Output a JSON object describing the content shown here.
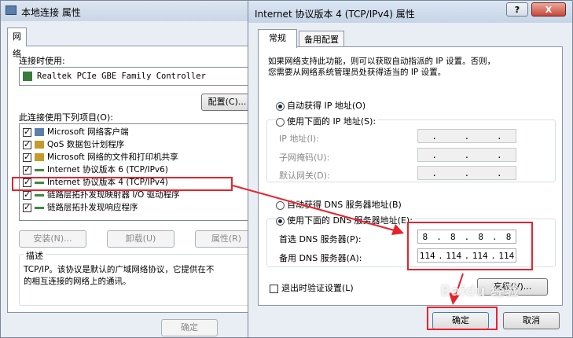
{
  "back_window": {
    "title": "本地连接 属性",
    "tab": "网络",
    "connect_using_label": "连接时使用:",
    "adapter_name": "Realtek PCIe GBE Family Controller",
    "configure_button": "配置(C)...",
    "items_label": "此连接使用下列项目(O):",
    "items": [
      {
        "label": "Microsoft 网络客户端",
        "checked": true
      },
      {
        "label": "QoS 数据包计划程序",
        "checked": true
      },
      {
        "label": "Microsoft 网络的文件和打印机共享",
        "checked": true
      },
      {
        "label": "Internet 协议版本 6 (TCP/IPv6)",
        "checked": true
      },
      {
        "label": "Internet 协议版本 4 (TCP/IPv4)",
        "checked": true
      },
      {
        "label": "链路层拓扑发现映射器 I/O 驱动程序",
        "checked": true
      },
      {
        "label": "链路层拓扑发现响应程序",
        "checked": true
      }
    ],
    "install_button": "安装(N)...",
    "uninstall_button": "卸载(U)",
    "properties_button": "属性(R)",
    "description_title": "描述",
    "description_line1": "TCP/IP。该协议是默认的广域网络协议，它提供在不",
    "description_line2": "的相互连接的网络上的通讯。",
    "ok_button": "确定"
  },
  "front_window": {
    "title": "Internet 协议版本 4 (TCP/IPv4) 属性",
    "help_button": "?",
    "close_button": "X",
    "tabs": [
      "常规",
      "备用配置"
    ],
    "intro_line1": "如果网络支持此功能，则可以获取自动指派的 IP 设置。否则，",
    "intro_line2": "您需要从网络系统管理员处获得适当的 IP 设置。",
    "auto_ip_label": "自动获得 IP 地址(O)",
    "manual_ip_label": "使用下面的 IP 地址(S):",
    "ip_address_label": "IP 地址(I):",
    "subnet_label": "子网掩码(U):",
    "gateway_label": "默认网关(D):",
    "auto_dns_label": "自动获得 DNS 服务器地址(B)",
    "manual_dns_label": "使用下面的 DNS 服务器地址(E):",
    "preferred_dns_label": "首选 DNS 服务器(P):",
    "alternate_dns_label": "备用 DNS 服务器(A):",
    "preferred_dns": [
      "8",
      "8",
      "8",
      "8"
    ],
    "alternate_dns": [
      "114",
      "114",
      "114",
      "114"
    ],
    "validate_label": "退出时验证设置(L)",
    "advanced_button": "高级(V)...",
    "ok_button": "确定",
    "cancel_button": "取消"
  },
  "annotation": {
    "highlight_color": "#e8222d",
    "watermark": "Baidu 经验"
  }
}
